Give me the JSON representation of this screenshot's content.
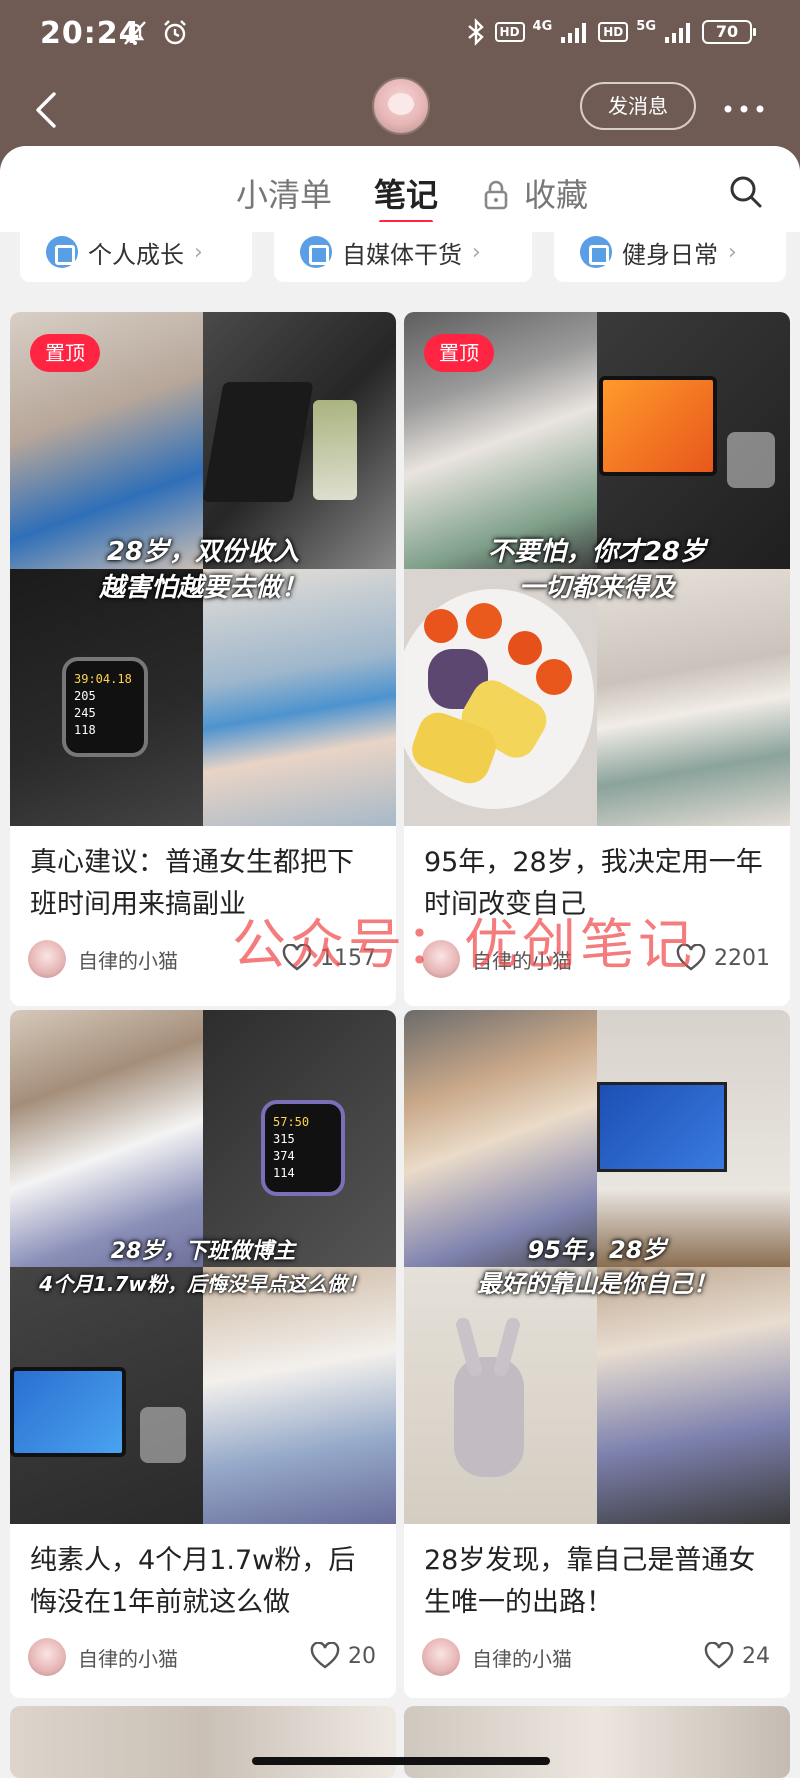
{
  "status_bar": {
    "time": "20:24",
    "network1": "4G",
    "network2": "5G",
    "hd_label": "HD",
    "battery": "70"
  },
  "header": {
    "send_message": "发消息"
  },
  "tabs": [
    {
      "label": "小清单"
    },
    {
      "label": "笔记"
    },
    {
      "label": "收藏"
    }
  ],
  "chips": [
    {
      "label": "个人成长"
    },
    {
      "label": "自媒体干货"
    },
    {
      "label": "健身日常"
    }
  ],
  "cards": [
    {
      "pinned": "置顶",
      "overlay_line1": "28岁，双份收入",
      "overlay_line2": "越害怕越要去做！",
      "title": "真心建议：普通女生都把下班时间用来搞副业",
      "author": "自律的小猫",
      "likes": "1157"
    },
    {
      "pinned": "置顶",
      "overlay_line1": "不要怕，你才28岁",
      "overlay_line2": "一切都来得及",
      "title": "95年，28岁，我决定用一年时间改变自己",
      "author": "自律的小猫",
      "likes": "2201"
    },
    {
      "overlay_line1": "28岁，下班做博主",
      "overlay_line2": "4个月1.7w粉，后悔没早点这么做！",
      "title": "纯素人，4个月1.7w粉，后悔没在1年前就这么做",
      "author": "自律的小猫",
      "likes": "20"
    },
    {
      "overlay_line1": "95年，28岁",
      "overlay_line2": "最好的靠山是你自己！",
      "title": "28岁发现，靠自己是普通女生唯一的出路！",
      "author": "自律的小猫",
      "likes": "24"
    }
  ],
  "watch1": {
    "time": "39:04.18",
    "v1": "205",
    "v2": "245",
    "v3": "118"
  },
  "watch2": {
    "time": "57:50",
    "v1": "315",
    "v2": "374",
    "v3": "114"
  },
  "watermark": "公众号：优创笔记",
  "colors": {
    "accent": "#ff2442",
    "header_bg": "#6f5b54",
    "chip_icon": "#5a9ee6"
  }
}
